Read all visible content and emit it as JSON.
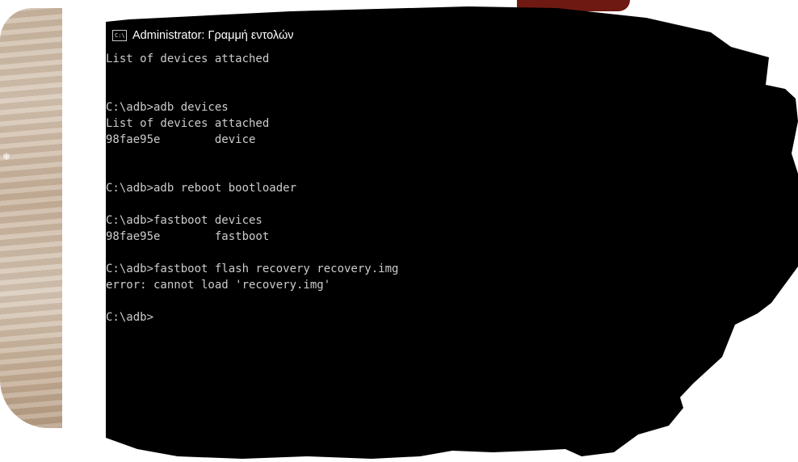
{
  "window": {
    "title": "Administrator: Γραμμή εντολών",
    "icon": "cmd-icon",
    "icon_glyph": "C:\\."
  },
  "console": {
    "lines": [
      "List of devices attached",
      "",
      "",
      "C:\\adb>adb devices",
      "List of devices attached",
      "98fae95e        device",
      "",
      "",
      "C:\\adb>adb reboot bootloader",
      "",
      "C:\\adb>fastboot devices",
      "98fae95e        fastboot",
      "",
      "C:\\adb>fastboot flash recovery recovery.img",
      "error: cannot load 'recovery.img'",
      "",
      "C:\\adb>"
    ]
  },
  "colors": {
    "console_background": "#000000",
    "console_text": "#cccccc",
    "title_text": "#ffffff"
  }
}
